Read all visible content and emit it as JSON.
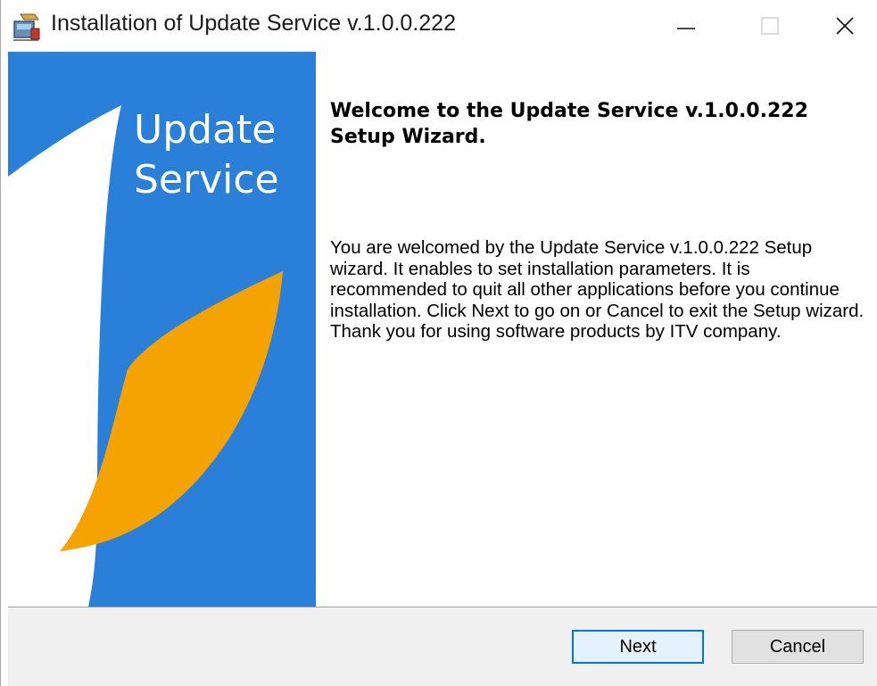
{
  "window": {
    "title": "Installation of Update Service v.1.0.0.222",
    "controls": [
      "minimize-icon",
      "maximize-icon",
      "close-icon"
    ]
  },
  "banner": {
    "title_line1": "Update",
    "title_line2": "Service",
    "colors": {
      "background": "#2a7fd9",
      "accent": "#f5a300",
      "swoosh": "#ffffff"
    }
  },
  "welcome": {
    "title": "Welcome to the Update Service v.1.0.0.222 Setup Wizard.",
    "body": "You are welcomed by the Update Service v.1.0.0.222 Setup wizard. It enables to set installation parameters. It is recommended to quit all other applications before you continue installation. Click Next to go on or Cancel to exit the Setup wizard. Thank you for using software products by ITV company."
  },
  "buttons": {
    "next_label": "Next",
    "cancel_label": "Cancel"
  }
}
